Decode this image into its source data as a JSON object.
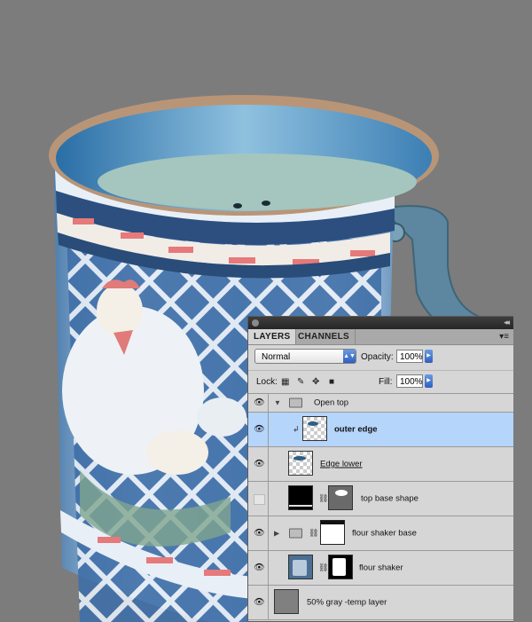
{
  "panel": {
    "tabs": [
      {
        "label": "LAYERS",
        "active": true
      },
      {
        "label": "CHANNELS",
        "active": false
      }
    ],
    "blend_mode": "Normal",
    "opacity_label": "Opacity:",
    "opacity_value": "100%",
    "lock_label": "Lock:",
    "fill_label": "Fill:",
    "fill_value": "100%",
    "layers": [
      {
        "name": "Open top",
        "kind": "group",
        "visible": true,
        "expanded": true
      },
      {
        "name": "outer edge",
        "kind": "layer",
        "visible": true,
        "selected": true,
        "clipped": true
      },
      {
        "name": "Edge lower",
        "kind": "layer",
        "visible": true
      },
      {
        "name": "top base shape",
        "kind": "layer-mask",
        "visible": false
      },
      {
        "name": "flour shaker base",
        "kind": "group-mask",
        "visible": true
      },
      {
        "name": "flour shaker",
        "kind": "layer-mask",
        "visible": true
      },
      {
        "name": "50% gray -temp layer",
        "kind": "layer",
        "visible": true
      }
    ]
  },
  "colors": {
    "background": "#7c7c7c",
    "selected_row": "#b5d5fb",
    "panel_bg": "#d6d6d6"
  }
}
